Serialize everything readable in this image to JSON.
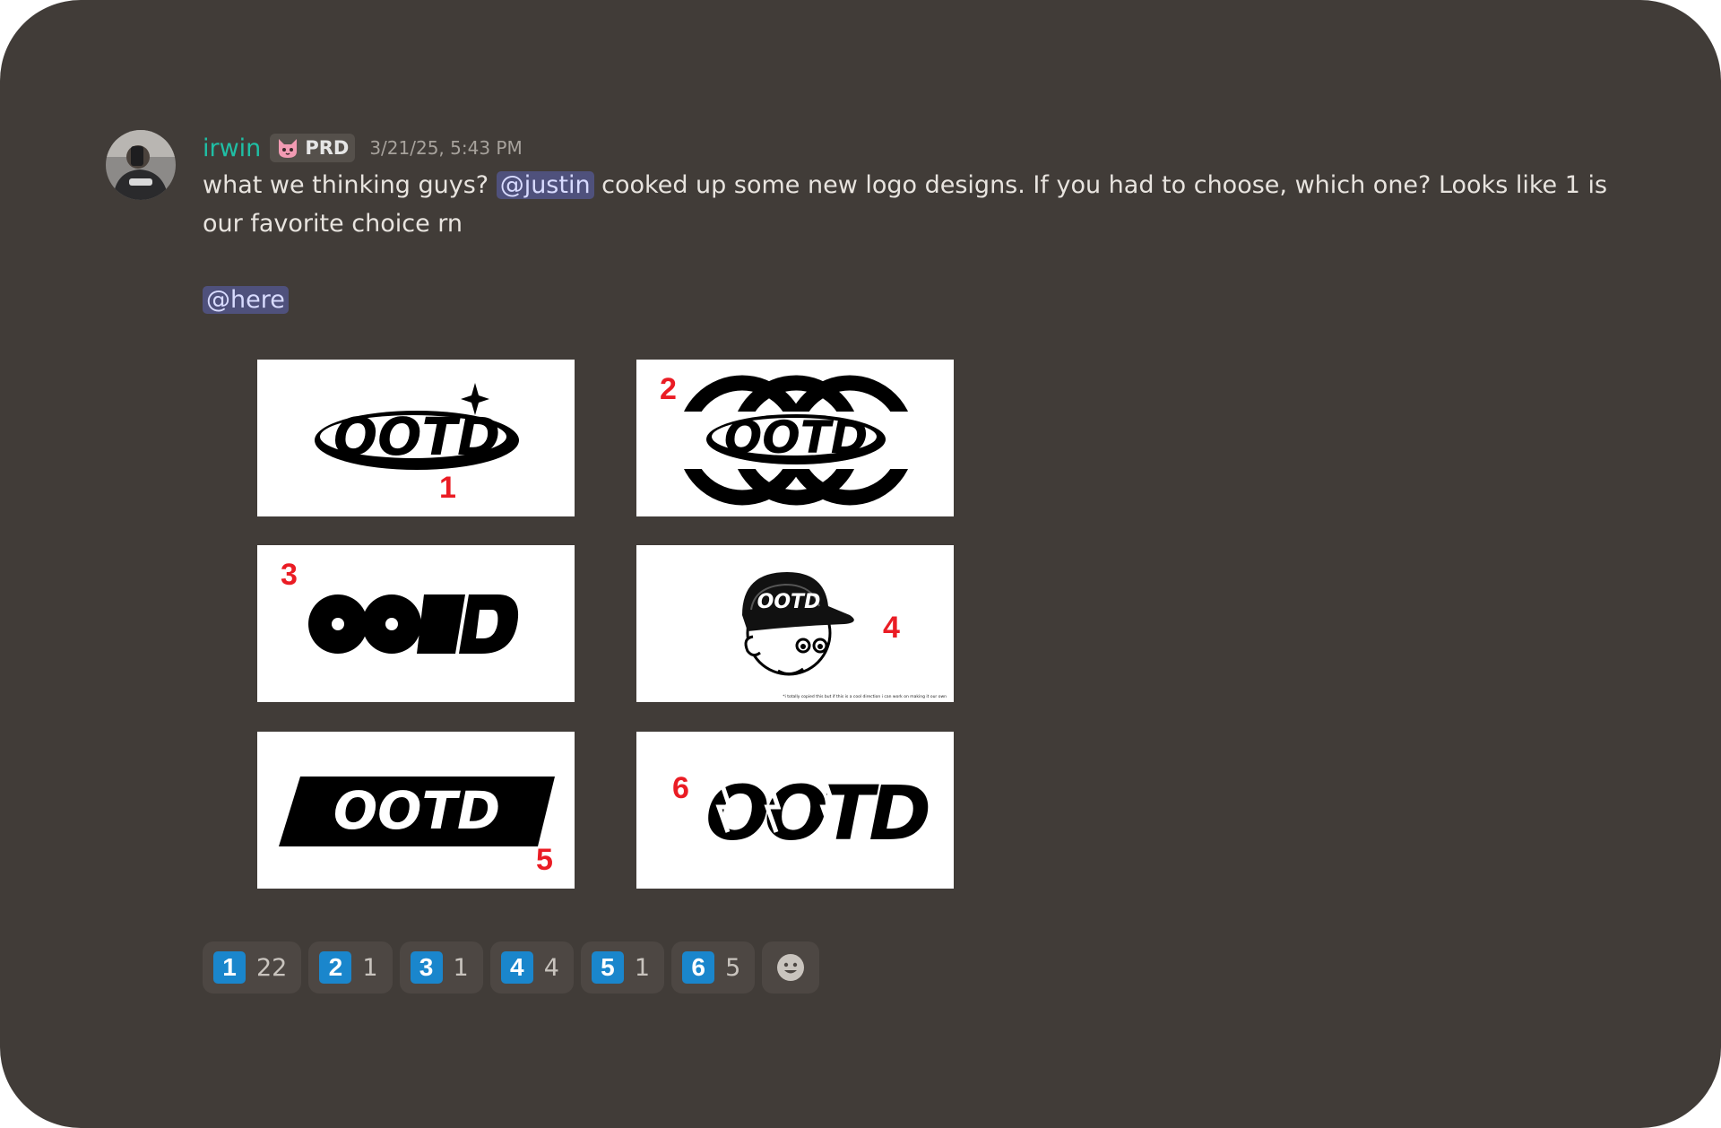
{
  "message": {
    "author": "irwin",
    "role_badge": "PRD",
    "timestamp": "3/21/25, 5:43 PM",
    "text_before_mention": "what we thinking guys? ",
    "mention_user": "@justin",
    "text_after_mention": " cooked up some new logo designs. If you had to choose, which one? Looks like 1 is our favorite choice rn",
    "mention_here": "@here"
  },
  "attachments": [
    {
      "wordmark": "OOTD",
      "number": "1"
    },
    {
      "wordmark": "OOTD",
      "number": "2"
    },
    {
      "wordmark": "OOTD",
      "number": "3"
    },
    {
      "wordmark": "OOTD",
      "number": "4",
      "footnote": "*i totally copied this but if this is a cool direction i can work on making it our own"
    },
    {
      "wordmark": "OOTD",
      "number": "5"
    },
    {
      "wordmark": "OOTD",
      "number": "6"
    }
  ],
  "reactions": [
    {
      "emoji": "1",
      "count": "22"
    },
    {
      "emoji": "2",
      "count": "1"
    },
    {
      "emoji": "3",
      "count": "1"
    },
    {
      "emoji": "4",
      "count": "4"
    },
    {
      "emoji": "5",
      "count": "1"
    },
    {
      "emoji": "6",
      "count": "5"
    }
  ],
  "colors": {
    "background": "#413c38",
    "username": "#1fbfa5",
    "mention_bg": "#4f517c",
    "keycap": "#1a86cc",
    "logo_number": "#ea1c24"
  },
  "icons": {
    "add_reaction": "smiley-face-icon",
    "role_badge": "pink-cat-icon"
  }
}
